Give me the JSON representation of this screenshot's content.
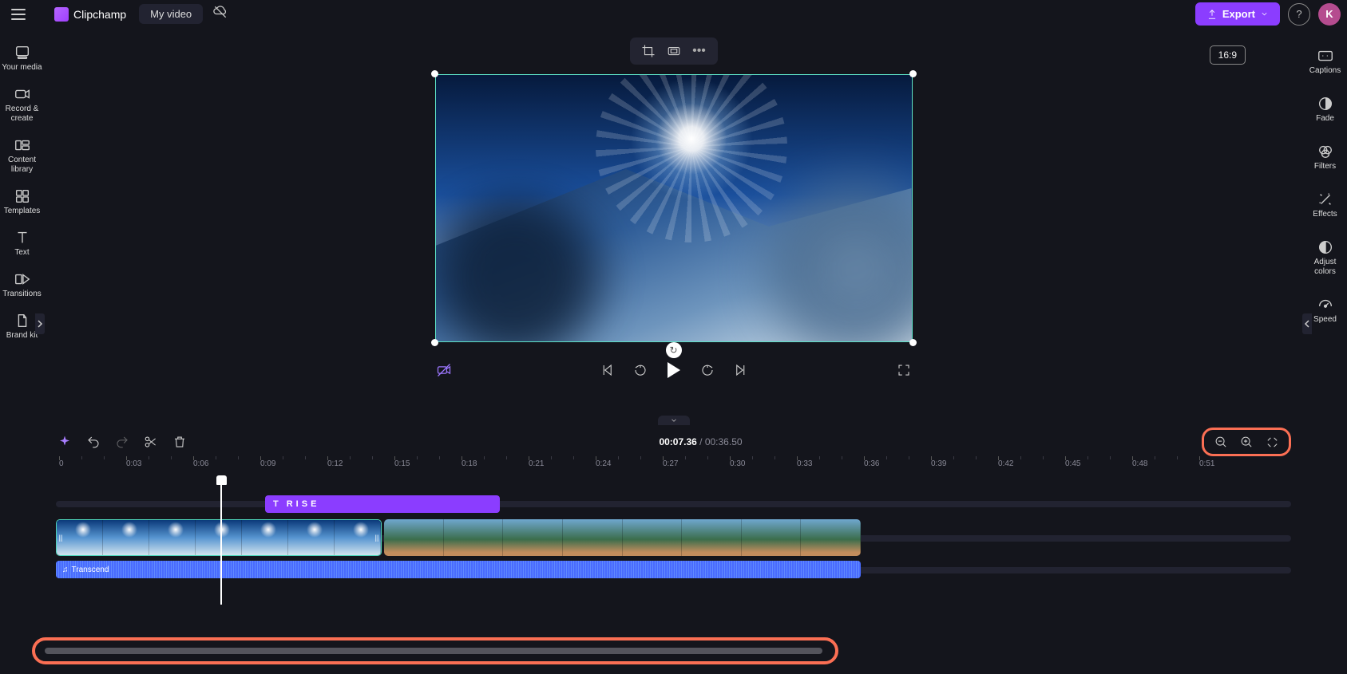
{
  "header": {
    "brand": "Clipchamp",
    "project_name": "My video",
    "export_label": "Export",
    "avatar_initial": "K"
  },
  "left_sidebar": {
    "items": [
      {
        "key": "your-media",
        "label": "Your media"
      },
      {
        "key": "record-create",
        "label": "Record & create"
      },
      {
        "key": "content-library",
        "label": "Content library"
      },
      {
        "key": "templates",
        "label": "Templates"
      },
      {
        "key": "text",
        "label": "Text"
      },
      {
        "key": "transitions",
        "label": "Transitions"
      },
      {
        "key": "brand-kit",
        "label": "Brand kit"
      }
    ]
  },
  "right_sidebar": {
    "items": [
      {
        "key": "captions",
        "label": "Captions"
      },
      {
        "key": "fade",
        "label": "Fade"
      },
      {
        "key": "filters",
        "label": "Filters"
      },
      {
        "key": "effects",
        "label": "Effects"
      },
      {
        "key": "adjust-colors",
        "label": "Adjust colors"
      },
      {
        "key": "speed",
        "label": "Speed"
      }
    ]
  },
  "preview": {
    "aspect_ratio": "16:9"
  },
  "playback": {
    "current_time": "00:07.36",
    "total_time": "00:36.50",
    "separator": " / "
  },
  "timeline": {
    "ruler_ticks": [
      "0",
      "0:03",
      "0:06",
      "0:09",
      "0:12",
      "0:15",
      "0:18",
      "0:21",
      "0:24",
      "0:27",
      "0:30",
      "0:33",
      "0:36",
      "0:39",
      "0:42",
      "0:45",
      "0:48",
      "0:51"
    ],
    "text_clip_label": "RISE",
    "audio_clip_label": "Transcend"
  },
  "colors": {
    "accent": "#8b3dff",
    "annotation": "#fb6f54",
    "select": "#4ed6bb",
    "audio": "#496bff"
  }
}
